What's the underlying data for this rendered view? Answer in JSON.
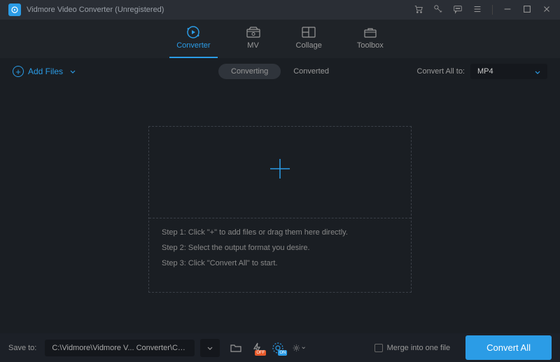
{
  "titlebar": {
    "app_name": "Vidmore Video Converter (Unregistered)"
  },
  "nav": {
    "tabs": [
      {
        "label": "Converter",
        "active": true
      },
      {
        "label": "MV",
        "active": false
      },
      {
        "label": "Collage",
        "active": false
      },
      {
        "label": "Toolbox",
        "active": false
      }
    ]
  },
  "toolbar": {
    "add_files_label": "Add Files",
    "sub_tabs": {
      "converting": "Converting",
      "converted": "Converted"
    },
    "convert_all_to_label": "Convert All to:",
    "selected_format": "MP4"
  },
  "drop_zone": {
    "step1": "Step 1: Click \"+\" to add files or drag them here directly.",
    "step2": "Step 2: Select the output format you desire.",
    "step3": "Step 3: Click \"Convert All\" to start."
  },
  "footer": {
    "save_to_label": "Save to:",
    "save_path": "C:\\Vidmore\\Vidmore V... Converter\\Converted",
    "merge_label": "Merge into one file",
    "convert_all_btn": "Convert All"
  }
}
